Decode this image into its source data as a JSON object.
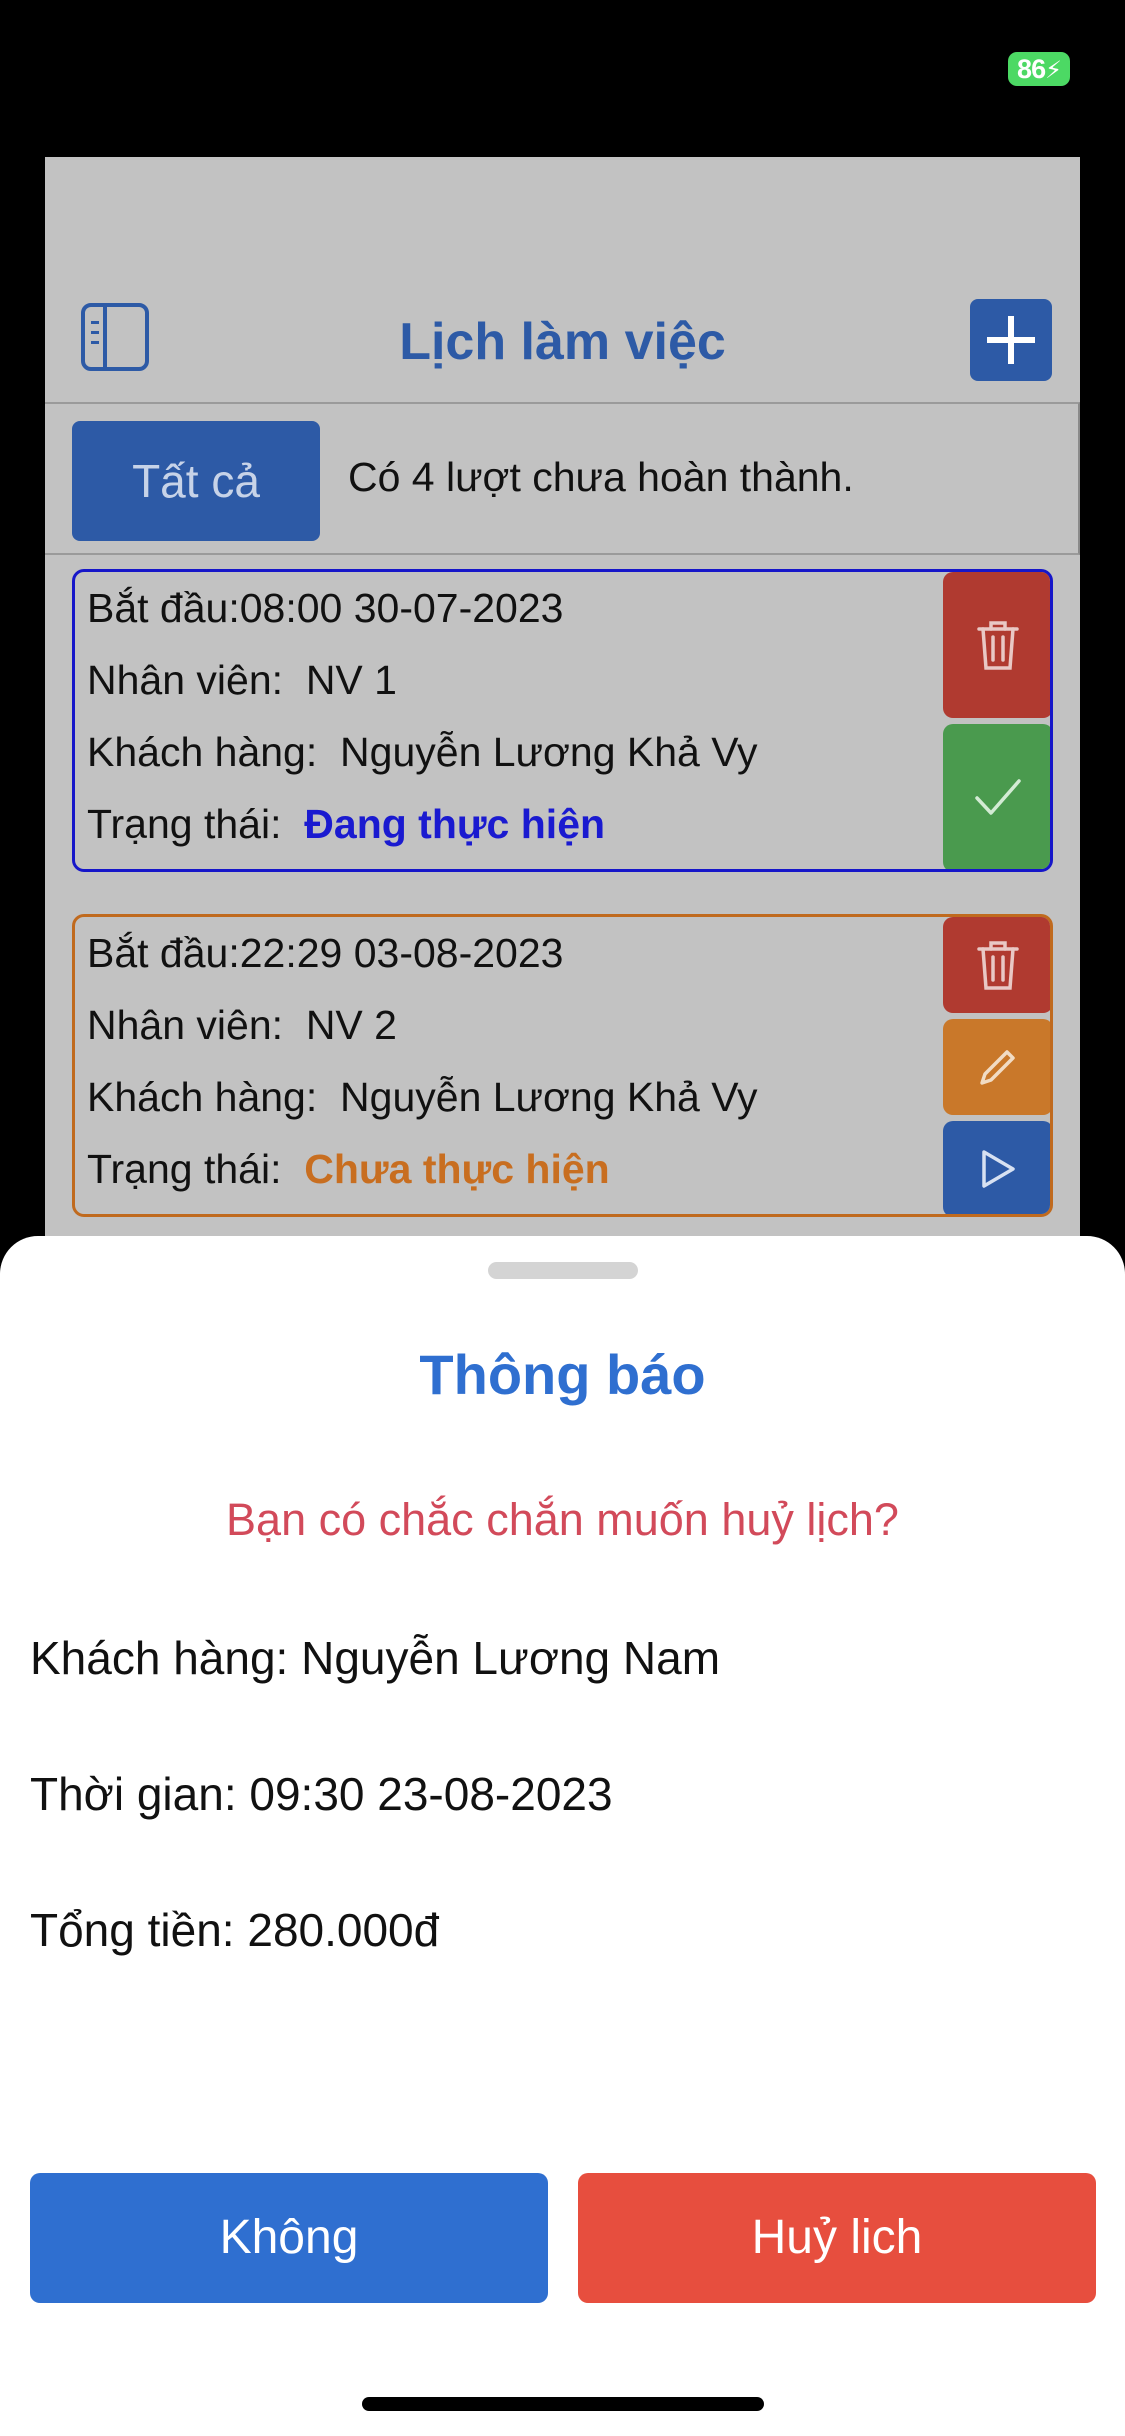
{
  "status_bar": {
    "battery_percent": "86"
  },
  "nav": {
    "title": "Lịch làm việc"
  },
  "filter": {
    "button_label": "Tất cả",
    "summary": "Có 4 lượt chưa hoàn thành."
  },
  "labels": {
    "start": "Bắt đầu:",
    "staff": "Nhân viên:",
    "customer": "Khách hàng:",
    "status": "Trạng thái:"
  },
  "cards": [
    {
      "start": "08:00 30-07-2023",
      "staff": "NV 1",
      "customer": "Nguyễn Lương Khả Vy",
      "status": "Đang thực hiện",
      "status_color": "#1a1ad0",
      "actions": [
        "trash-icon",
        "check-icon"
      ]
    },
    {
      "start": "22:29 03-08-2023",
      "staff": "NV 2",
      "customer": "Nguyễn Lương Khả Vy",
      "status": "Chưa thực hiện",
      "status_color": "#c86e20",
      "actions": [
        "trash-icon",
        "pencil-icon",
        "play-icon"
      ]
    }
  ],
  "sheet": {
    "title": "Thông báo",
    "question": "Bạn có chắc chắn muốn huỷ lịch?",
    "customer_line": "Khách hàng: Nguyễn Lương Nam",
    "time_line": "Thời gian: 09:30 23-08-2023",
    "total_line": "Tổng tiền: 280.000đ",
    "cancel_label": "Không",
    "confirm_label": "Huỷ lich"
  },
  "colors": {
    "primary": "#2f6fd0",
    "danger": "#e74e3e",
    "question": "#d24a5a"
  }
}
